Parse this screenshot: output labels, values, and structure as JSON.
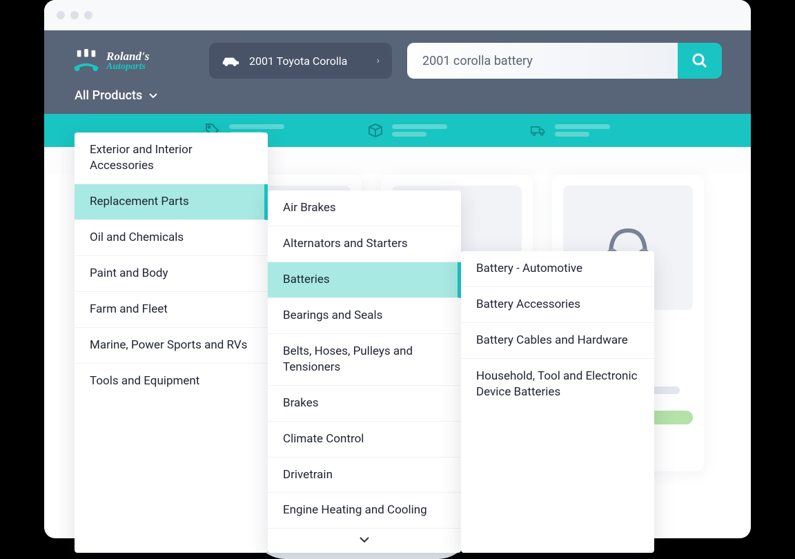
{
  "logo": {
    "line1": "Roland's",
    "line2": "Autoparts"
  },
  "vehicle": {
    "label": "2001 Toyota Corolla"
  },
  "search": {
    "value": "2001 corolla battery"
  },
  "nav": {
    "all_products": "All Products"
  },
  "menu": {
    "level1": [
      "Exterior and Interior Accessories",
      "Replacement Parts",
      "Oil and Chemicals",
      "Paint and Body",
      "Farm and Fleet",
      "Marine, Power Sports and RVs",
      "Tools and Equipment"
    ],
    "level1_active_index": 1,
    "level2": [
      "Air Brakes",
      "Alternators and Starters",
      "Batteries",
      "Bearings and Seals",
      "Belts, Hoses, Pulleys and Tensioners",
      "Brakes",
      "Climate Control",
      "Drivetrain",
      "Engine Heating and Cooling"
    ],
    "level2_active_index": 2,
    "level3": [
      "Battery - Automotive",
      "Battery Accessories",
      "Battery Cables and Hardware",
      "Household, Tool and Electronic Device Batteries"
    ]
  }
}
